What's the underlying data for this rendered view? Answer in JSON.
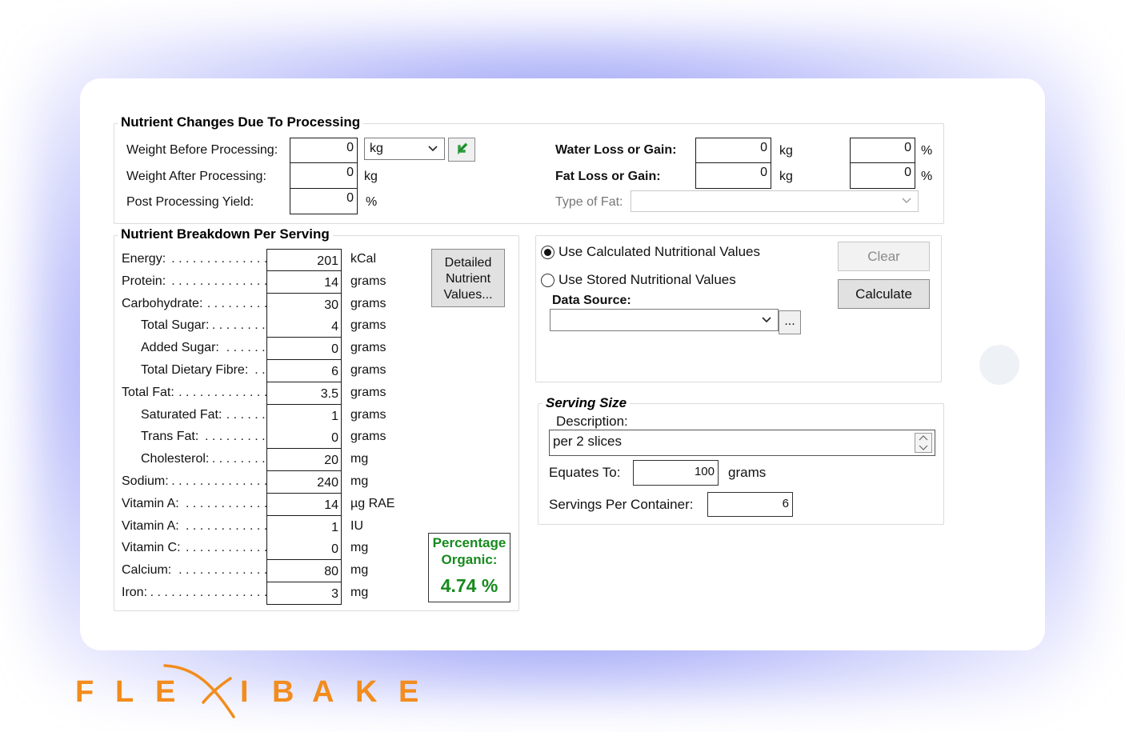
{
  "processing": {
    "title": "Nutrient Changes Due To Processing",
    "weight_before_label": "Weight Before Processing:",
    "weight_before_value": "0",
    "weight_unit_select": "kg",
    "weight_after_label": "Weight After Processing:",
    "weight_after_value": "0",
    "weight_after_unit": "kg",
    "yield_label": "Post Processing Yield:",
    "yield_value": "0",
    "yield_unit": "%",
    "water_label": "Water Loss or Gain:",
    "water_value": "0",
    "water_unit": "kg",
    "water_pct": "0",
    "water_pct_unit": "%",
    "fat_label": "Fat Loss or Gain:",
    "fat_value": "0",
    "fat_unit": "kg",
    "fat_pct": "0",
    "fat_pct_unit": "%",
    "fat_type_label": "Type of Fat:",
    "fat_type_value": ""
  },
  "breakdown": {
    "title": "Nutrient Breakdown Per Serving",
    "detailed_button": "Detailed Nutrient Values...",
    "rows": [
      {
        "label": "Energy:",
        "value": "201",
        "unit": "kCal",
        "indent": false
      },
      {
        "label": "Protein:",
        "value": "14",
        "unit": "grams",
        "indent": false
      },
      {
        "label": "Carbohydrate:",
        "value": "30",
        "unit": "grams",
        "indent": false
      },
      {
        "label": "Total Sugar:",
        "value": "4",
        "unit": "grams",
        "indent": true
      },
      {
        "label": "Added Sugar:",
        "value": "0",
        "unit": "grams",
        "indent": true
      },
      {
        "label": "Total Dietary Fibre:",
        "value": "6",
        "unit": "grams",
        "indent": true
      },
      {
        "label": "Total Fat:",
        "value": "3.5",
        "unit": "grams",
        "indent": false
      },
      {
        "label": "Saturated Fat:",
        "value": "1",
        "unit": "grams",
        "indent": true
      },
      {
        "label": "Trans Fat:",
        "value": "0",
        "unit": "grams",
        "indent": true
      },
      {
        "label": "Cholesterol:",
        "value": "20",
        "unit": "mg",
        "indent": true
      },
      {
        "label": "Sodium:",
        "value": "240",
        "unit": "mg",
        "indent": false
      },
      {
        "label": "Vitamin A:",
        "value": "14",
        "unit": "µg RAE",
        "indent": false
      },
      {
        "label": "Vitamin A:",
        "value": "1",
        "unit": "IU",
        "indent": false
      },
      {
        "label": "Vitamin C:",
        "value": "0",
        "unit": "mg",
        "indent": false
      },
      {
        "label": "Calcium:",
        "value": "80",
        "unit": "mg",
        "indent": false
      },
      {
        "label": "Iron:",
        "value": "3",
        "unit": "mg",
        "indent": false
      }
    ],
    "organic_label": "Percentage Organic:",
    "organic_value": "4.74 %"
  },
  "source": {
    "radio_calculated": "Use Calculated Nutritional Values",
    "radio_stored": "Use Stored Nutritional Values",
    "selected": "calculated",
    "data_source_label": "Data Source:",
    "data_source_value": "",
    "browse_button": "...",
    "clear_button": "Clear",
    "calculate_button": "Calculate"
  },
  "serving": {
    "title": "Serving Size",
    "description_label": "Description:",
    "description_value": "per 2 slices",
    "equates_label": "Equates To:",
    "equates_value": "100",
    "equates_unit": "grams",
    "per_container_label": "Servings Per Container:",
    "per_container_value": "6"
  },
  "logo": {
    "text": "FLEXIBAKE",
    "color": "#f28c1c"
  },
  "colors": {
    "organic_green": "#178a1f",
    "arrow_green": "#2e9e3a",
    "glow_blue": "#6b74f0"
  }
}
